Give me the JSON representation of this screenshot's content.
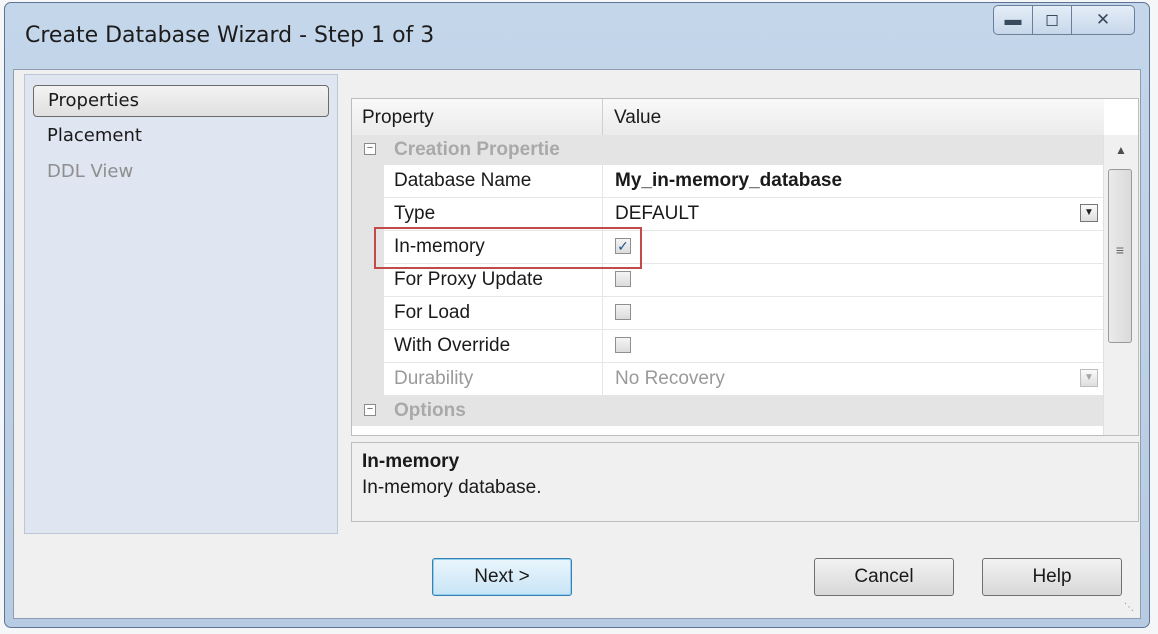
{
  "window": {
    "title": "Create Database Wizard - Step 1 of 3"
  },
  "icons": {
    "minimize": "minimize-icon",
    "maximize": "maximize-icon",
    "close": "close-icon"
  },
  "nav": {
    "items": [
      {
        "label": "Properties",
        "state": "selected"
      },
      {
        "label": "Placement",
        "state": "normal"
      },
      {
        "label": "DDL View",
        "state": "disabled"
      }
    ]
  },
  "grid": {
    "header": {
      "property": "Property",
      "value": "Value"
    },
    "categories": [
      "Creation Propertie",
      "Options"
    ],
    "rows": [
      {
        "name": "Database Name",
        "value": "My_in-memory_database"
      },
      {
        "name": "Type",
        "value": "DEFAULT"
      },
      {
        "name": "In-memory",
        "checked": true
      },
      {
        "name": "For Proxy Update",
        "checked": false
      },
      {
        "name": "For Load",
        "checked": false
      },
      {
        "name": "With Override",
        "checked": false
      },
      {
        "name": "Durability",
        "value": "No Recovery"
      }
    ]
  },
  "description": {
    "title": "In-memory",
    "text": "In-memory database."
  },
  "buttons": {
    "next": "Next >",
    "cancel": "Cancel",
    "help": "Help"
  },
  "colors": {
    "highlight": "#c44a4a",
    "title_bar": "#c4d6ea"
  }
}
